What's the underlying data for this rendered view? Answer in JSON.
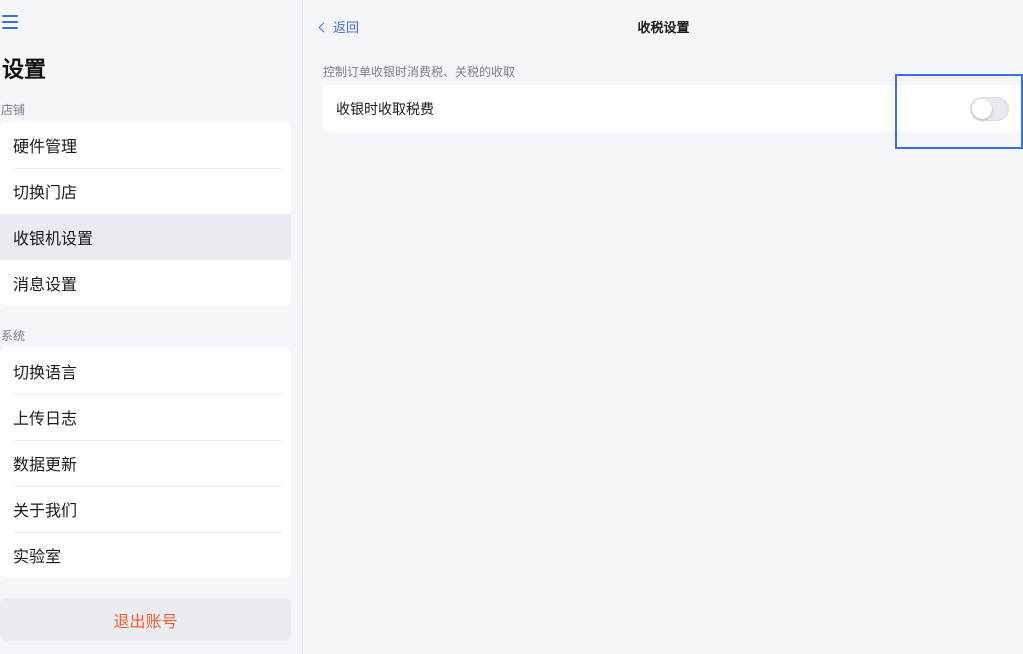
{
  "sidebar": {
    "title": "设置",
    "store_section": {
      "label": "店铺",
      "items": [
        {
          "label": "硬件管理"
        },
        {
          "label": "切换门店"
        },
        {
          "label": "收银机设置"
        },
        {
          "label": "消息设置"
        }
      ]
    },
    "system_section": {
      "label": "系统",
      "items": [
        {
          "label": "切换语言"
        },
        {
          "label": "上传日志"
        },
        {
          "label": "数据更新"
        },
        {
          "label": "关于我们"
        },
        {
          "label": "实验室"
        }
      ]
    },
    "logout_label": "退出账号",
    "active_item": "收银机设置"
  },
  "header": {
    "back_label": "返回",
    "title": "收税设置"
  },
  "main": {
    "description": "控制订单收银时消费税、关税的收取",
    "setting": {
      "label": "收银时收取税费",
      "enabled": false
    }
  },
  "colors": {
    "accent": "#3b6fe0",
    "logout": "#f0602f",
    "background": "#f5f6fa"
  }
}
